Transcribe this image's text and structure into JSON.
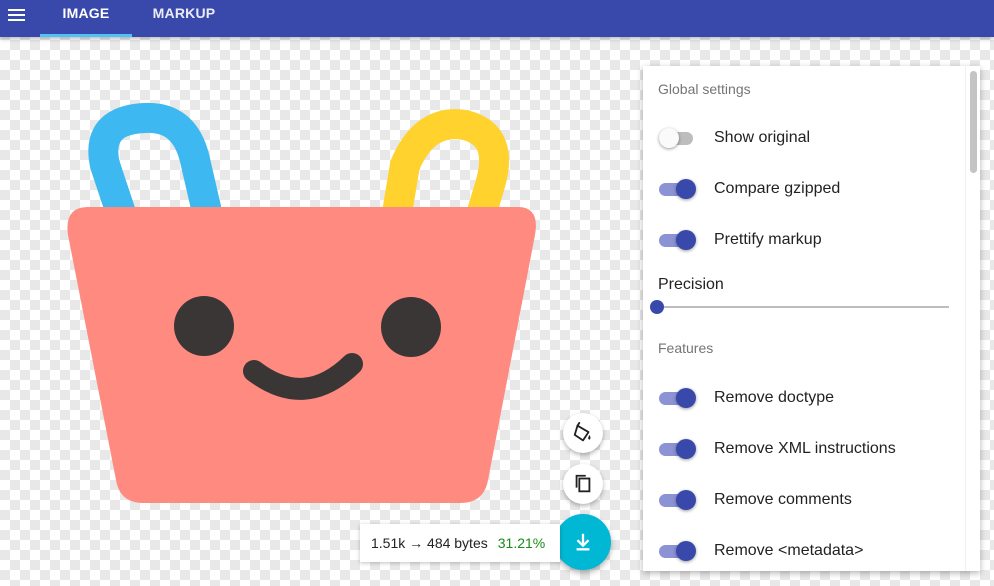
{
  "topbar": {
    "menu_icon": "hamburger-menu-icon",
    "tabs": [
      {
        "label": "IMAGE",
        "active": true
      },
      {
        "label": "MARKUP",
        "active": false
      }
    ],
    "color": "#3949ab",
    "indicator_color": "#4fc3f7"
  },
  "artwork": {
    "basket_color": "#ff8a80",
    "left_handle_color": "#3db8f0",
    "right_handle_color": "#ffd22e",
    "face_color": "#3a3636"
  },
  "actions": {
    "bucket_icon": "paint-bucket-icon",
    "copy_icon": "copy-icon",
    "download_icon": "download-icon",
    "download_color": "#00b8d4"
  },
  "size": {
    "summary": "1.51k → 484 bytes",
    "percent": "31.21%"
  },
  "settings": {
    "global_title": "Global settings",
    "global": [
      {
        "label": "Show original",
        "on": false
      },
      {
        "label": "Compare gzipped",
        "on": true
      },
      {
        "label": "Prettify markup",
        "on": true
      }
    ],
    "precision_label": "Precision",
    "precision_value": 0,
    "features_title": "Features",
    "features": [
      {
        "label": "Remove doctype",
        "on": true
      },
      {
        "label": "Remove XML instructions",
        "on": true
      },
      {
        "label": "Remove comments",
        "on": true
      },
      {
        "label": "Remove <metadata>",
        "on": true
      }
    ]
  }
}
